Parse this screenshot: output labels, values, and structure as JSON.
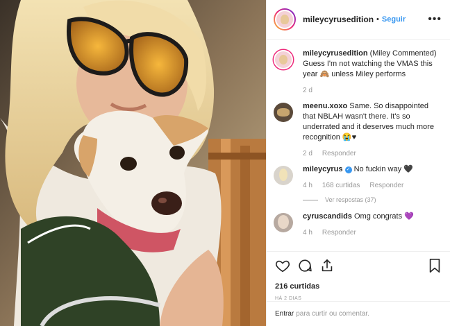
{
  "post": {
    "username": "mileycyrusedition",
    "follow_label": "Seguir",
    "separator": "•",
    "more": "•••"
  },
  "comments": [
    {
      "username": "mileycyrusedition",
      "text": "(Miley Commented) Guess I'm not watching the VMAS this year 🙈 unless Miley performs",
      "time": "2 d",
      "likes": "",
      "reply": ""
    },
    {
      "username": "meenu.xoxo",
      "text": "Same. So disappointed that NBLAH wasn't there. It's so underrated and it deserves much more recognition 😭♥",
      "time": "2 d",
      "likes": "",
      "reply": "Responder"
    },
    {
      "username": "mileycyrus",
      "verified": true,
      "text": "No fuckin way 🖤",
      "time": "4 h",
      "likes": "168 curtidas",
      "reply": "Responder",
      "view_replies": "Ver respostas (37)"
    },
    {
      "username": "cyruscandids",
      "text": "Omg congrats 💜",
      "time": "4 h",
      "likes": "",
      "reply": "Responder"
    }
  ],
  "actions": {
    "like_icon": "heart-icon",
    "comment_icon": "comment-icon",
    "share_icon": "share-icon",
    "save_icon": "bookmark-icon",
    "likes_count": "216 curtidas",
    "posted": "HÁ 2 DIAS"
  },
  "footer": {
    "login_label": "Entrar",
    "prompt": "para curtir ou comentar."
  },
  "colors": {
    "link_blue": "#3897f0",
    "muted": "#999999",
    "text": "#262626"
  }
}
